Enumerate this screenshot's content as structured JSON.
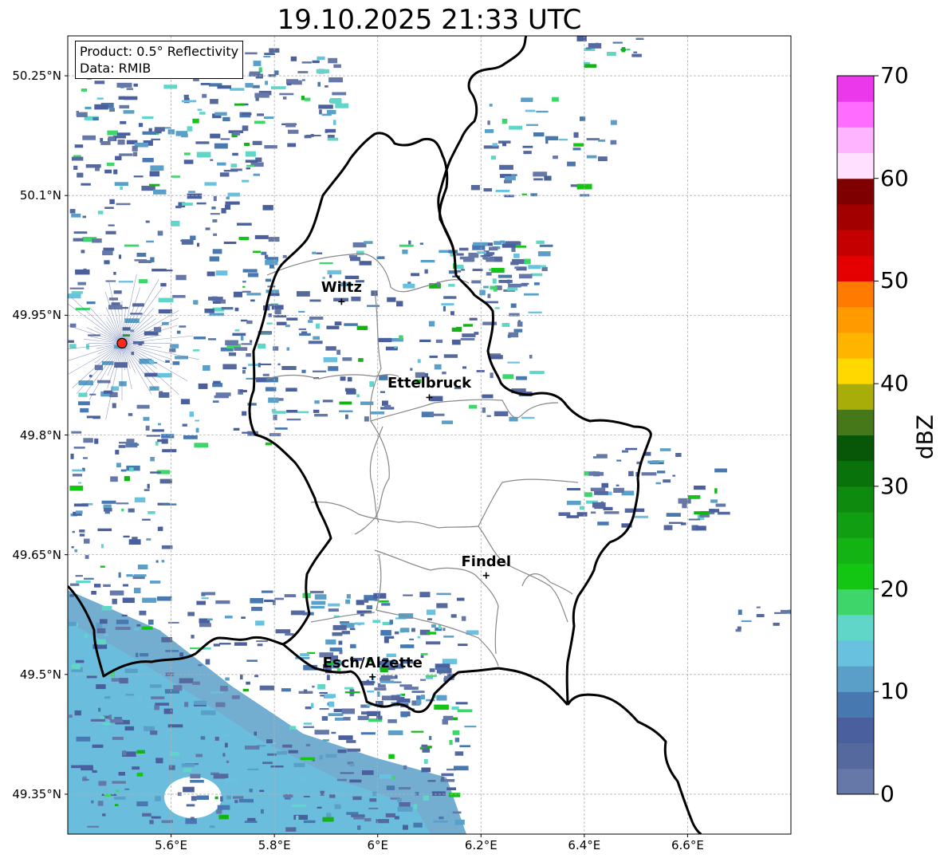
{
  "title": "19.10.2025 21:33 UTC",
  "info": {
    "product": "Product: 0.5° Reflectivity",
    "data_source": "Data: RMIB"
  },
  "lat_ticks": [
    {
      "value": 50.25,
      "label": "50.25°N"
    },
    {
      "value": 50.1,
      "label": "50.1°N"
    },
    {
      "value": 49.95,
      "label": "49.95°N"
    },
    {
      "value": 49.8,
      "label": "49.8°N"
    },
    {
      "value": 49.65,
      "label": "49.65°N"
    },
    {
      "value": 49.5,
      "label": "49.5°N"
    },
    {
      "value": 49.35,
      "label": "49.35°N"
    }
  ],
  "lon_ticks": [
    {
      "value": 5.6,
      "label": "5.6°E"
    },
    {
      "value": 5.8,
      "label": "5.8°E"
    },
    {
      "value": 6.0,
      "label": "6°E"
    },
    {
      "value": 6.2,
      "label": "6.2°E"
    },
    {
      "value": 6.4,
      "label": "6.4°E"
    },
    {
      "value": 6.6,
      "label": "6.6°E"
    }
  ],
  "extent": {
    "lon_min": 5.4,
    "lon_max": 6.8,
    "lat_min": 49.3,
    "lat_max": 50.3
  },
  "radar_site": {
    "lon": 5.505,
    "lat": 49.915,
    "color": "#ff2a1a"
  },
  "cities": [
    {
      "name": "Wiltz",
      "lon": 5.93,
      "lat": 49.967
    },
    {
      "name": "Ettelbruck",
      "lon": 6.1,
      "lat": 49.847
    },
    {
      "name": "Findel",
      "lon": 6.21,
      "lat": 49.624
    },
    {
      "name": "Esch/Alzette",
      "lon": 5.99,
      "lat": 49.497
    }
  ],
  "colorbar": {
    "label": "dBZ",
    "min": 0,
    "max": 70,
    "step": 2.5,
    "ticks": [
      0,
      10,
      20,
      30,
      40,
      50,
      60,
      70
    ],
    "colors": [
      "#6678a8",
      "#55699e",
      "#4a5f9e",
      "#4878b0",
      "#5a9fc8",
      "#68c1de",
      "#5fd6c8",
      "#3ed66a",
      "#14c614",
      "#12b312",
      "#129e12",
      "#0e8a0e",
      "#0a720a",
      "#085608",
      "#46781a",
      "#a9ad0a",
      "#ffd800",
      "#ffb400",
      "#ff9a00",
      "#ff7a00",
      "#e40000",
      "#c40000",
      "#a20000",
      "#7e0000",
      "#ffe0ff",
      "#ffb4ff",
      "#ff6cff",
      "#ea38ea"
    ]
  },
  "colors": {
    "border": "#000000",
    "cantons": "#888888",
    "grid": "#b0b0b0"
  }
}
